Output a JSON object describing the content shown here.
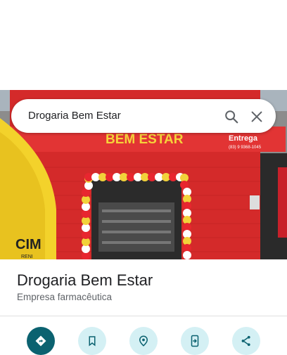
{
  "search": {
    "query": "Drogaria Bem Estar"
  },
  "photo": {
    "sign_name": "BEM ESTAR",
    "sign_delivery": "Entrega",
    "sign_phone": "(83) 9 9368-1045",
    "side_banner": "CIM",
    "side_banner_sub": "RENI"
  },
  "place": {
    "name": "Drogaria Bem Estar",
    "category": "Empresa farmacêutica"
  },
  "actions": [
    {
      "icon": "directions-icon"
    },
    {
      "icon": "bookmark-icon"
    },
    {
      "icon": "nearby-icon"
    },
    {
      "icon": "send-to-phone-icon"
    },
    {
      "icon": "share-icon"
    }
  ],
  "colors": {
    "accent": "#0b6270",
    "action_bg": "#d4f0f4",
    "storefront_red": "#d92a2a",
    "sign_yellow": "#f6d33a"
  }
}
